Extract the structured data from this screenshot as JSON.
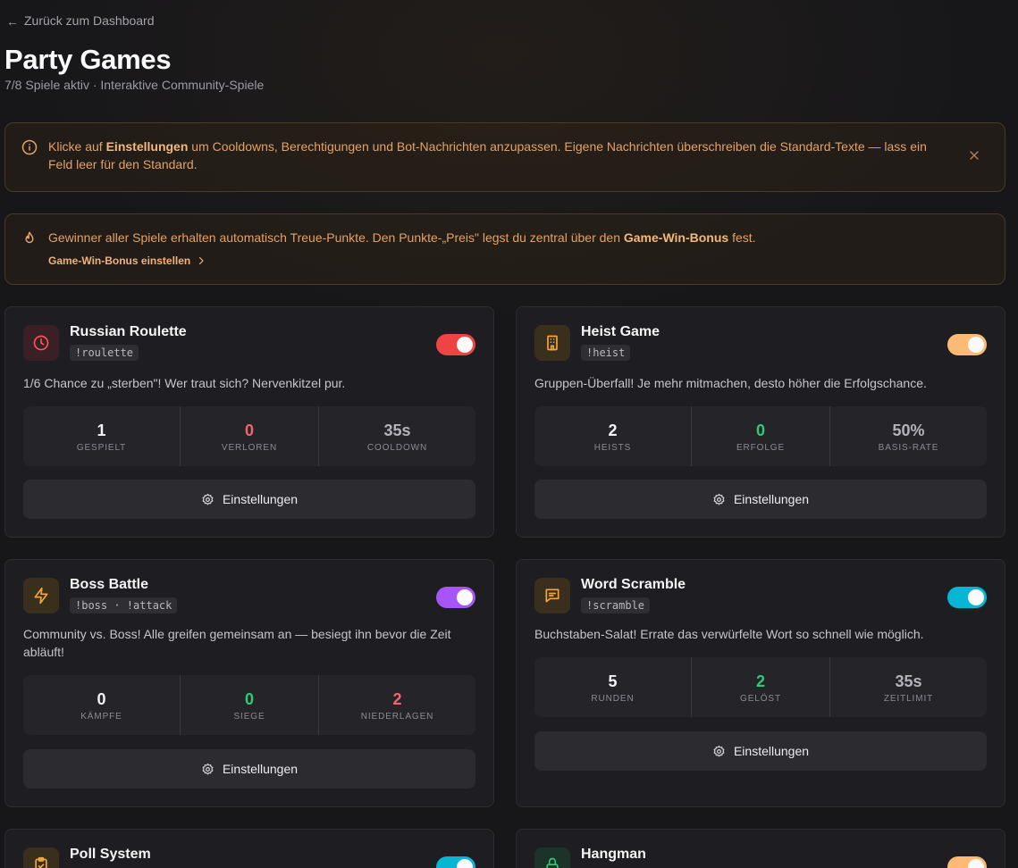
{
  "nav": {
    "back_label": "Zurück zum Dashboard"
  },
  "header": {
    "title": "Party Games",
    "subtitle": "7/8 Spiele aktiv · Interaktive Community-Spiele"
  },
  "info_banner": {
    "text_before": "Klicke auf ",
    "text_bold": "Einstellungen",
    "text_after": " um Cooldowns, Berechtigungen und Bot-Nachrichten anzupassen. Eigene Nachrichten überschreiben die Standard-Texte — lass ein Feld leer für den Standard."
  },
  "reward_banner": {
    "text_before": "Gewinner aller Spiele erhalten automatisch Treue-Punkte. Den Punkte-„Preis\" legst du zentral über den ",
    "text_bold": "Game-Win-Bonus",
    "text_after": " fest.",
    "link_label": "Game-Win-Bonus einstellen"
  },
  "colors": {
    "accent_orange": "#e3a167",
    "toggle_red": "#ef4444",
    "toggle_orange": "#fdba74",
    "toggle_purple": "#a855f7",
    "toggle_cyan": "#06b6d4"
  },
  "games": [
    {
      "name": "Russian Roulette",
      "command": "!roulette",
      "description": "1/6 Chance zu „sterben\"! Wer traut sich? Nervenkitzel pur.",
      "icon": "clock-icon",
      "enabled": true,
      "stats": [
        {
          "value": "1",
          "label": "Gespielt"
        },
        {
          "value": "0",
          "label": "Verloren"
        },
        {
          "value": "35s",
          "label": "Cooldown"
        }
      ],
      "settings_label": "Einstellungen"
    },
    {
      "name": "Heist Game",
      "command": "!heist",
      "description": "Gruppen-Überfall! Je mehr mitmachen, desto höher die Erfolgschance.",
      "icon": "building-icon",
      "enabled": true,
      "stats": [
        {
          "value": "2",
          "label": "Heists"
        },
        {
          "value": "0",
          "label": "Erfolge"
        },
        {
          "value": "50%",
          "label": "Basis-Rate"
        }
      ],
      "settings_label": "Einstellungen"
    },
    {
      "name": "Boss Battle",
      "command": "!boss · !attack",
      "description": "Community vs. Boss! Alle greifen gemeinsam an — besiegt ihn bevor die Zeit abläuft!",
      "icon": "lightning-icon",
      "enabled": true,
      "stats": [
        {
          "value": "0",
          "label": "Kämpfe"
        },
        {
          "value": "0",
          "label": "Siege"
        },
        {
          "value": "2",
          "label": "Niederlagen"
        }
      ],
      "settings_label": "Einstellungen"
    },
    {
      "name": "Word Scramble",
      "command": "!scramble",
      "description": "Buchstaben-Salat! Errate das verwürfelte Wort so schnell wie möglich.",
      "icon": "message-icon",
      "enabled": true,
      "stats": [
        {
          "value": "5",
          "label": "Runden"
        },
        {
          "value": "2",
          "label": "Gelöst"
        },
        {
          "value": "35s",
          "label": "Zeitlimit"
        }
      ],
      "settings_label": "Einstellungen"
    },
    {
      "name": "Poll System",
      "icon": "clipboard-icon",
      "enabled": true
    },
    {
      "name": "Hangman",
      "icon": "lock-icon",
      "enabled": true
    }
  ]
}
